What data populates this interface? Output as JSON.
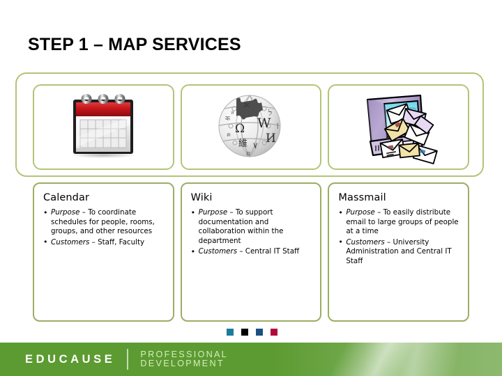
{
  "slide": {
    "title": "STEP 1 – MAP SERVICES"
  },
  "services": [
    {
      "icon": "calendar-icon",
      "heading": "Calendar",
      "bullets": [
        {
          "label": "Purpose",
          "dash": " – ",
          "text": "To coordinate schedules for people, rooms, groups, and other resources"
        },
        {
          "label": "Customers",
          "dash": " – ",
          "text": "Staff, Faculty"
        }
      ]
    },
    {
      "icon": "wikipedia-globe-icon",
      "heading": "Wiki",
      "bullets": [
        {
          "label": "Purpose",
          "dash": " – ",
          "text": "To support documentation and collaboration within the department"
        },
        {
          "label": "Customers",
          "dash": " – ",
          "text": "Central IT Staff"
        }
      ]
    },
    {
      "icon": "massmail-computer-icon",
      "heading": "Massmail",
      "bullets": [
        {
          "label": "Purpose",
          "dash": " – ",
          "text": "To easily distribute email to large groups of people at a time"
        },
        {
          "label": "Customers",
          "dash": " – ",
          "text": "University Administration and Central IT Staff"
        }
      ]
    }
  ],
  "squares": [
    {
      "name": "square-teal",
      "color": "#1b7b9e"
    },
    {
      "name": "square-black",
      "color": "#000000"
    },
    {
      "name": "square-blue",
      "color": "#1b4f82"
    },
    {
      "name": "square-red",
      "color": "#b30a3e"
    }
  ],
  "footer": {
    "brand": "EDUCAUSE",
    "sub_line1": "PROFESSIONAL",
    "sub_line2": "DEVELOPMENT",
    "background_color": "#5c9b31"
  },
  "theme": {
    "frame_border": "#b3c478",
    "card_border": "#9cad63",
    "calendar_red": "#c4151c",
    "page_background": "#ffffff"
  },
  "wiki_glyphs": {
    "w": "W",
    "omega": "Ω",
    "cyrillic_i": "И",
    "han": "維",
    "lamed": "ל",
    "seven": "٧"
  }
}
